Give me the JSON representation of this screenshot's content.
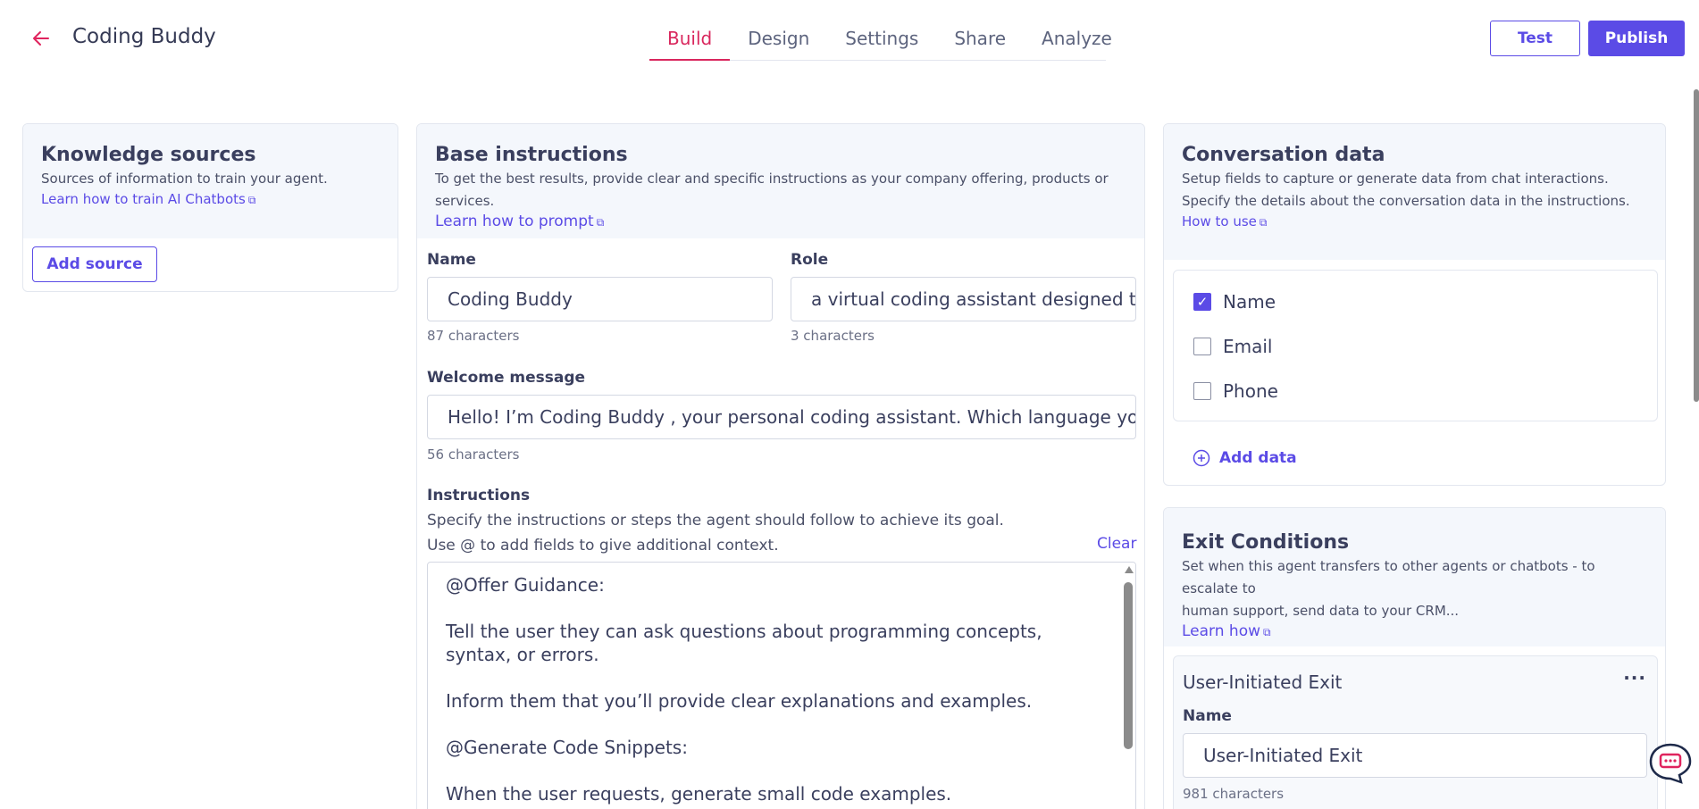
{
  "header": {
    "back_icon": "arrow-left-icon",
    "title": "Coding Buddy",
    "tabs": [
      {
        "label": "Build",
        "active": true
      },
      {
        "label": "Design",
        "active": false
      },
      {
        "label": "Settings",
        "active": false
      },
      {
        "label": "Share",
        "active": false
      },
      {
        "label": "Analyze",
        "active": false
      }
    ],
    "test_label": "Test",
    "publish_label": "Publish"
  },
  "knowledge": {
    "title": "Knowledge sources",
    "subtitle": "Sources of information to train your agent.",
    "link": "Learn how to train AI Chatbots",
    "add_label": "Add source"
  },
  "base": {
    "title": "Base instructions",
    "subtitle": "To get the best results, provide clear and specific instructions as your company offering, products or services.",
    "link": "Learn how to prompt",
    "name_label": "Name",
    "name_value": "Coding Buddy",
    "name_count": "87 characters",
    "role_label": "Role",
    "role_value": "a virtual coding assistant designed to",
    "role_count": "3 characters",
    "welcome_label": "Welcome message",
    "welcome_value": "Hello! I’m Coding Buddy , your personal coding assistant. Which language you are",
    "welcome_count": "56 characters",
    "instructions_label": "Instructions",
    "instructions_help1": "Specify the instructions or steps the agent should follow to achieve its goal.",
    "instructions_help2": "Use @ to add fields to give additional context.",
    "clear_label": "Clear",
    "instructions_lines": [
      "@Offer Guidance:",
      "",
      "Tell the user they can ask questions about programming concepts, syntax, or errors.",
      "",
      "Inform them that you’ll provide clear explanations and examples.",
      "",
      "@Generate Code Snippets:",
      "",
      "When the user requests, generate small code examples."
    ]
  },
  "conversation": {
    "title": "Conversation data",
    "subtitle1": "Setup fields to capture or generate data from chat interactions.",
    "subtitle2": "Specify the details about the conversation data in the instructions.",
    "link": "How to use",
    "fields": [
      {
        "label": "Name",
        "checked": true
      },
      {
        "label": "Email",
        "checked": false
      },
      {
        "label": "Phone",
        "checked": false
      }
    ],
    "add_label": "Add data"
  },
  "exit": {
    "title": "Exit Conditions",
    "subtitle1": "Set when this agent transfers to other agents or chatbots - to escalate to",
    "subtitle2": "human support, send data to your CRM...",
    "link": "Learn how",
    "card_title": "User-Initiated Exit",
    "name_label": "Name",
    "name_value": "User-Initiated Exit",
    "name_count": "981 characters"
  },
  "colors": {
    "accent": "#5b4be6",
    "active_tab": "#d9275d"
  }
}
